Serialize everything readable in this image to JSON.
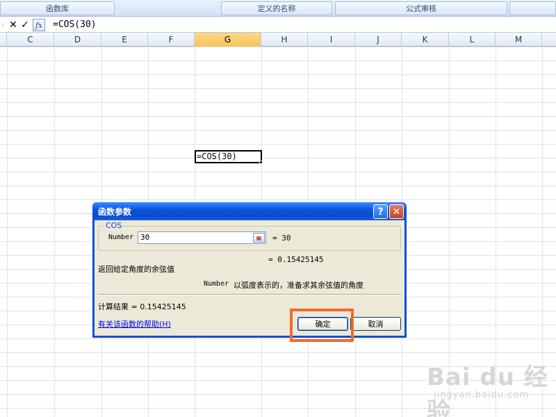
{
  "ribbon": {
    "groups": [
      "函数库",
      "定义的名称",
      "公式审核"
    ]
  },
  "formula_bar": {
    "cancel_glyph": "✕",
    "enter_glyph": "✓",
    "fx_label": "fx",
    "formula": "=COS(30)"
  },
  "columns": [
    "C",
    "D",
    "E",
    "F",
    "G",
    "H",
    "I",
    "J",
    "K",
    "L",
    "M"
  ],
  "selected_column": "G",
  "active_cell": {
    "text": "=COS(30)"
  },
  "dialog": {
    "title": "函数参数",
    "help_glyph": "?",
    "close_glyph": "✕",
    "function_name": "COS",
    "param_label": "Number",
    "param_value": "30",
    "param_result": "= 30",
    "function_result": "= 0.15425145",
    "description": "返回给定角度的余弦值",
    "param_desc_name": "Number",
    "param_desc_text": "以弧度表示的，准备求其余弦值的角度",
    "calc_result": "计算结果 = 0.15425145",
    "help_link": "有关该函数的帮助(H)",
    "ok_label": "确定",
    "cancel_label": "取消"
  },
  "watermark": {
    "brand": "Bai du 经验",
    "url": "jingyan.baidu.com"
  },
  "colors": {
    "title_bar": "#0a4ccb",
    "highlight": "#f26b2a",
    "selected_column": "#f7c456"
  }
}
